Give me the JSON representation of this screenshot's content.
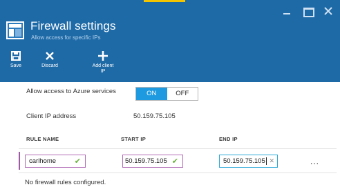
{
  "window_controls": {
    "minimize": "minimize",
    "maximize": "maximize",
    "close": "close"
  },
  "header": {
    "title": "Firewall settings",
    "subtitle": "Allow access for specific IPs",
    "background_color": "#1e6aa7",
    "accent_color": "#f5c400"
  },
  "toolbar": {
    "save_label": "Save",
    "discard_label": "Discard",
    "add_client_ip_label_line1": "Add client",
    "add_client_ip_label_line2": "IP"
  },
  "access": {
    "label": "Allow access to Azure services",
    "on_label": "ON",
    "off_label": "OFF",
    "selected": "ON",
    "on_color": "#1e9ae0"
  },
  "client_ip": {
    "label": "Client IP address",
    "value": "50.159.75.105"
  },
  "table": {
    "columns": [
      "RULE NAME",
      "START IP",
      "END IP"
    ],
    "rows": [
      {
        "name": "carlhome",
        "start_ip": "50.159.75.105",
        "end_ip": "50.159.75.105",
        "more": "..."
      }
    ],
    "empty_message": "No firewall rules configured."
  },
  "icons": {
    "save": "save-icon",
    "discard": "discard-icon",
    "add": "add-icon",
    "blade": "firewall-blade-icon",
    "valid": "checkmark-icon",
    "clear": "clear-icon"
  }
}
